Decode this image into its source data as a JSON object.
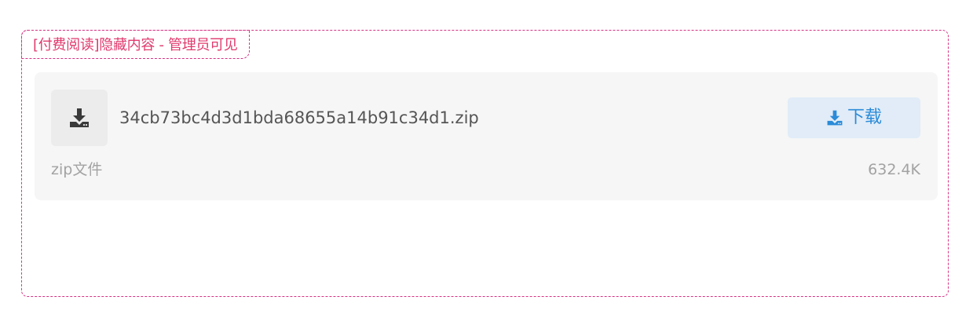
{
  "hidden_content": {
    "tag_label": "[付费阅读]隐藏内容 - 管理员可见",
    "accent_color": "#d63384"
  },
  "file": {
    "icon": "download-tray-icon",
    "name": "34cb73bc4d3d1bda68655a14b91c34d1.zip",
    "type_label": "zip文件",
    "size": "632.4K",
    "download_button": {
      "icon": "download-icon",
      "label": "下载",
      "color": "#2a8bd8"
    }
  }
}
